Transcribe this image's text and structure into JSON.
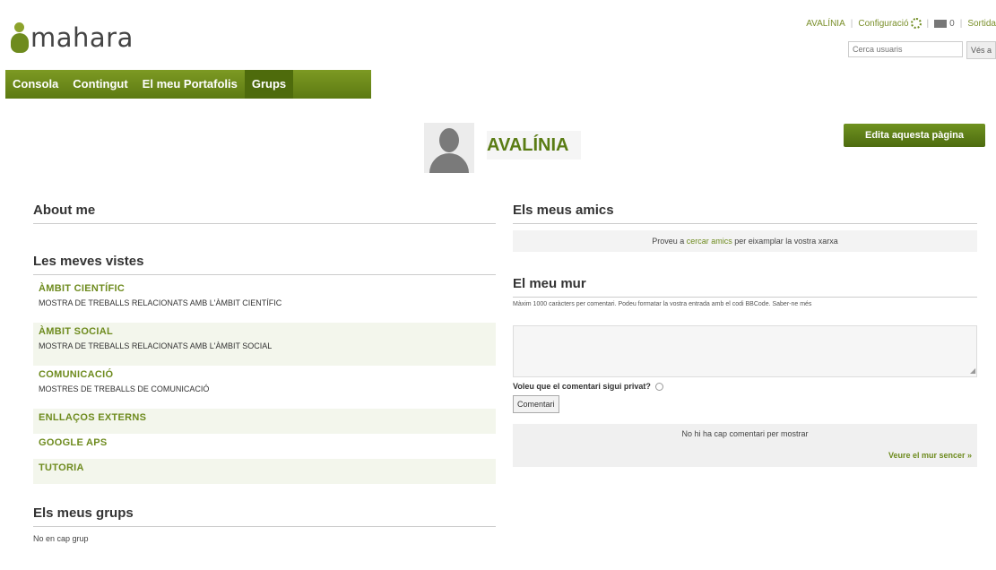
{
  "app": {
    "logo_text": "mahara",
    "brand_color": "#5c7a12",
    "accent_color": "#6e8b1e"
  },
  "topmenu": {
    "user": "AVALÍNIA",
    "settings": "Configuració",
    "inbox_count": "0",
    "logout": "Sortida",
    "search_placeholder": "Cerca usuaris",
    "search_button": "Vés a"
  },
  "nav": {
    "tabs": [
      "Consola",
      "Contingut",
      "El meu Portafolis",
      "Grups"
    ]
  },
  "profile": {
    "name": "AVALÍNIA",
    "edit_button": "Edita aquesta pàgina"
  },
  "left": {
    "about_title": "About me",
    "views_title": "Les meves vistes",
    "views": [
      {
        "title": "ÀMBIT CIENTÍFIC",
        "description": "MOSTRA DE TREBALLS RELACIONATS AMB L'ÀMBIT CIENTÍFIC"
      },
      {
        "title": "ÀMBIT SOCIAL",
        "description": "MOSTRA DE TREBALLS RELACIONATS AMB L'ÀMBIT SOCIAL"
      },
      {
        "title": "COMUNICACIÓ",
        "description": "MOSTRES DE TREBALLS DE COMUNICACIÓ"
      },
      {
        "title": "ENLLAÇOS EXTERNS",
        "description": ""
      },
      {
        "title": "GOOGLE APS",
        "description": ""
      },
      {
        "title": "TUTORIA",
        "description": ""
      }
    ],
    "groups_title": "Els meus grups",
    "groups_text": "No en cap grup"
  },
  "right": {
    "friends_title": "Els meus amics",
    "friends_msg_pre": "Proveu a",
    "friends_msg_link": "cercar amics",
    "friends_msg_post": "per eixamplar la vostra xarxa",
    "wall_title": "El meu mur",
    "wall_help": "Màxim 1000 caràcters per comentari. Podeu formatar la vostra entrada amb el codi BBCode. Saber-ne més",
    "private_label": "Voleu que el comentari sigui privat?",
    "comment_button": "Comentari",
    "no_comments": "No hi ha cap comentari per mostrar",
    "wall_more": "Veure el mur sencer »"
  }
}
